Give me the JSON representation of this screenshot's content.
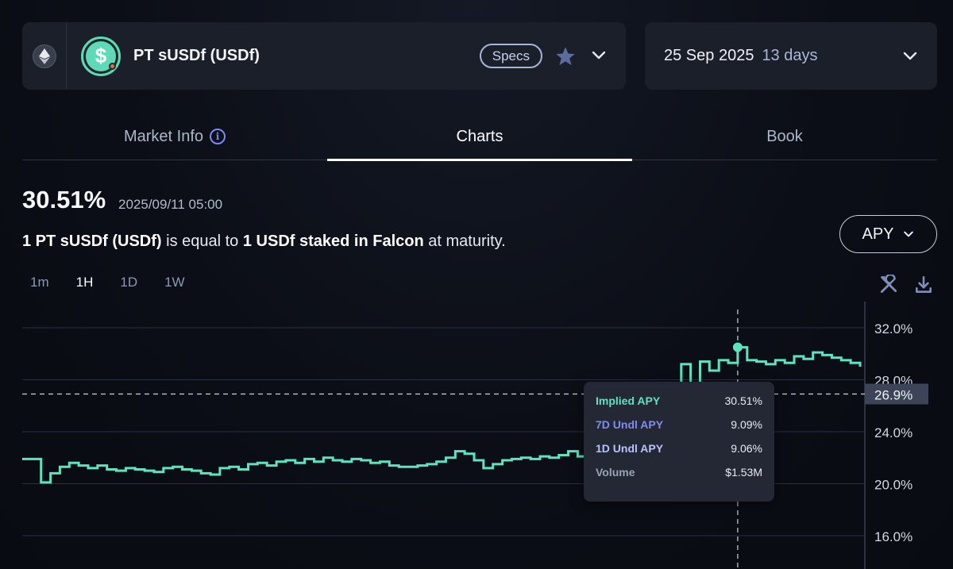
{
  "market": {
    "chain_icon": "ethereum-icon",
    "name": "PT sUSDf (USDf)",
    "specs_label": "Specs"
  },
  "maturity": {
    "date": "25 Sep 2025",
    "days": "13 days"
  },
  "tabs": [
    {
      "label": "Market Info"
    },
    {
      "label": "Charts"
    },
    {
      "label": "Book"
    }
  ],
  "summary": {
    "value": "30.51%",
    "timestamp": "2025/09/11 05:00",
    "desc_a": "1 PT sUSDf (USDf)",
    "desc_b": " is equal to ",
    "desc_c": "1 USDf staked in Falcon",
    "desc_d": " at maturity."
  },
  "metric_select": {
    "label": "APY"
  },
  "ranges": [
    "1m",
    "1H",
    "1D",
    "1W"
  ],
  "active_range": "1H",
  "colors": {
    "accent": "#5fe3bf",
    "undl7": "#7f8cf2",
    "undl1": "#b9c2ff",
    "volume": "#9aa3b5"
  },
  "tooltip": {
    "rows": [
      {
        "label": "Implied APY",
        "value": "30.51%"
      },
      {
        "label": "7D Undl APY",
        "value": "9.09%"
      },
      {
        "label": "1D Undl APY",
        "value": "9.06%"
      },
      {
        "label": "Volume",
        "value": "$1.53M"
      }
    ]
  },
  "chart_data": {
    "type": "line",
    "ylabel": "",
    "ylim": [
      15,
      33
    ],
    "y_ticks": [
      "32.0%",
      "28.0%",
      "24.0%",
      "20.0%",
      "16.0%"
    ],
    "y_tick_values": [
      32,
      28,
      24,
      20,
      16
    ],
    "reference_line": {
      "value": 26.9,
      "label": "26.9%"
    },
    "crosshair_index": 76,
    "series": [
      {
        "values": [
          21.9,
          21.9,
          20.1,
          20.8,
          21.3,
          21.6,
          21.4,
          21.2,
          21.4,
          21.1,
          21.0,
          21.2,
          21.1,
          21.0,
          20.9,
          21.2,
          21.3,
          21.1,
          21.0,
          20.8,
          20.7,
          21.2,
          21.3,
          21.1,
          21.5,
          21.6,
          21.4,
          21.7,
          21.8,
          21.6,
          21.9,
          21.7,
          22.0,
          21.8,
          21.7,
          21.9,
          21.8,
          21.6,
          21.7,
          21.4,
          21.3,
          21.3,
          21.4,
          21.5,
          21.7,
          22.0,
          22.5,
          22.3,
          21.8,
          21.2,
          21.5,
          21.8,
          21.9,
          22.0,
          21.9,
          22.1,
          22.0,
          22.2,
          22.5,
          22.1,
          22.3,
          22.4,
          22.6,
          22.8,
          22.7,
          22.9,
          22.6,
          22.8,
          22.7,
          22.9,
          29.2,
          23.0,
          29.4,
          28.7,
          29.5,
          29.3,
          30.5,
          29.5,
          29.4,
          29.2,
          29.5,
          29.3,
          29.8,
          29.6,
          30.1,
          29.9,
          29.7,
          29.5,
          29.3,
          29.0
        ]
      }
    ]
  }
}
